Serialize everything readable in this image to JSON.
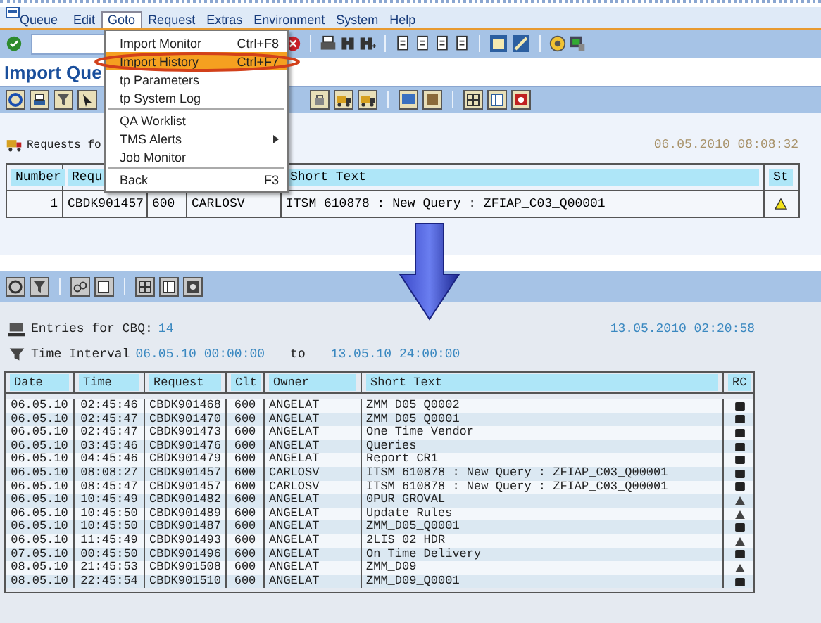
{
  "top_window": {
    "menu_bar": [
      {
        "label": "Queue",
        "selected": false
      },
      {
        "label": "Edit",
        "selected": false
      },
      {
        "label": "Goto",
        "selected": true
      },
      {
        "label": "Request",
        "selected": false
      },
      {
        "label": "Extras",
        "selected": false
      },
      {
        "label": "Environment",
        "selected": false
      },
      {
        "label": "System",
        "selected": false
      },
      {
        "label": "Help",
        "selected": false
      }
    ],
    "goto_menu": [
      {
        "kind": "item",
        "label": "Import Monitor",
        "shortcut": "Ctrl+F8",
        "selected": false
      },
      {
        "kind": "item",
        "label": "Import History",
        "shortcut": "Ctrl+F7",
        "selected": true
      },
      {
        "kind": "item",
        "label": "tp Parameters",
        "selected": false
      },
      {
        "kind": "item",
        "label": "tp System Log",
        "selected": false
      },
      {
        "kind": "separator"
      },
      {
        "kind": "item",
        "label": "QA Worklist",
        "selected": false
      },
      {
        "kind": "submenu",
        "label": "TMS Alerts",
        "selected": false
      },
      {
        "kind": "item",
        "label": "Job Monitor",
        "selected": false
      },
      {
        "kind": "separator"
      },
      {
        "kind": "item",
        "label": "Back",
        "shortcut": "F3",
        "selected": false
      }
    ],
    "title": "Import Que",
    "requests_label": "Requests fo",
    "timestamp": "06.05.2010 08:08:32",
    "table": {
      "columns": {
        "number": "Number",
        "request": "Requ",
        "short_text": "Short Text",
        "status": "St"
      },
      "rows": [
        {
          "number": "1",
          "request": "CBDK901457",
          "client": "600",
          "owner": "CARLOSV",
          "short_text": "ITSM 610878 : New Query : ZFIAP_C03_Q00001",
          "warning": true
        }
      ]
    }
  },
  "bottom_window": {
    "entries_label": "Entries for CBQ:",
    "entries_count": "14",
    "interval_label": "Time Interval",
    "interval_from": "06.05.10 00:00:00",
    "interval_to_label": "to",
    "interval_to": "13.05.10 24:00:00",
    "timestamp": "13.05.2010 02:20:58",
    "table": {
      "columns": [
        "Date",
        "Time",
        "Request",
        "Clt",
        "Owner",
        "Short Text",
        "RC"
      ],
      "rows": [
        {
          "date": "06.05.10",
          "time": "02:45:46",
          "request": "CBDK901468",
          "client": "600",
          "owner": "ANGELAT",
          "short_text": "ZMM_D05_Q0002",
          "warning": false
        },
        {
          "date": "06.05.10",
          "time": "02:45:47",
          "request": "CBDK901470",
          "client": "600",
          "owner": "ANGELAT",
          "short_text": "ZMM_D05_Q0001",
          "warning": false
        },
        {
          "date": "06.05.10",
          "time": "02:45:47",
          "request": "CBDK901473",
          "client": "600",
          "owner": "ANGELAT",
          "short_text": "One Time Vendor",
          "warning": false
        },
        {
          "date": "06.05.10",
          "time": "03:45:46",
          "request": "CBDK901476",
          "client": "600",
          "owner": "ANGELAT",
          "short_text": "Queries",
          "warning": false
        },
        {
          "date": "06.05.10",
          "time": "04:45:46",
          "request": "CBDK901479",
          "client": "600",
          "owner": "ANGELAT",
          "short_text": "Report CR1",
          "warning": false
        },
        {
          "date": "06.05.10",
          "time": "08:08:27",
          "request": "CBDK901457",
          "client": "600",
          "owner": "CARLOSV",
          "short_text": "ITSM 610878 : New Query : ZFIAP_C03_Q00001",
          "warning": false
        },
        {
          "date": "06.05.10",
          "time": "08:45:47",
          "request": "CBDK901457",
          "client": "600",
          "owner": "CARLOSV",
          "short_text": "ITSM 610878 : New Query : ZFIAP_C03_Q00001",
          "warning": false
        },
        {
          "date": "06.05.10",
          "time": "10:45:49",
          "request": "CBDK901482",
          "client": "600",
          "owner": "ANGELAT",
          "short_text": "0PUR_GROVAL",
          "warning": true
        },
        {
          "date": "06.05.10",
          "time": "10:45:50",
          "request": "CBDK901489",
          "client": "600",
          "owner": "ANGELAT",
          "short_text": "Update Rules",
          "warning": true
        },
        {
          "date": "06.05.10",
          "time": "10:45:50",
          "request": "CBDK901487",
          "client": "600",
          "owner": "ANGELAT",
          "short_text": "ZMM_D05_Q0001",
          "warning": false
        },
        {
          "date": "06.05.10",
          "time": "11:45:49",
          "request": "CBDK901493",
          "client": "600",
          "owner": "ANGELAT",
          "short_text": "2LIS_02_HDR",
          "warning": true
        },
        {
          "date": "07.05.10",
          "time": "00:45:50",
          "request": "CBDK901496",
          "client": "600",
          "owner": "ANGELAT",
          "short_text": "On Time Delivery",
          "warning": false
        },
        {
          "date": "08.05.10",
          "time": "21:45:53",
          "request": "CBDK901508",
          "client": "600",
          "owner": "ANGELAT",
          "short_text": "ZMM_D09",
          "warning": true
        },
        {
          "date": "08.05.10",
          "time": "22:45:54",
          "request": "CBDK901510",
          "client": "600",
          "owner": "ANGELAT",
          "short_text": "ZMM_D09_Q0001",
          "warning": false
        }
      ]
    }
  }
}
